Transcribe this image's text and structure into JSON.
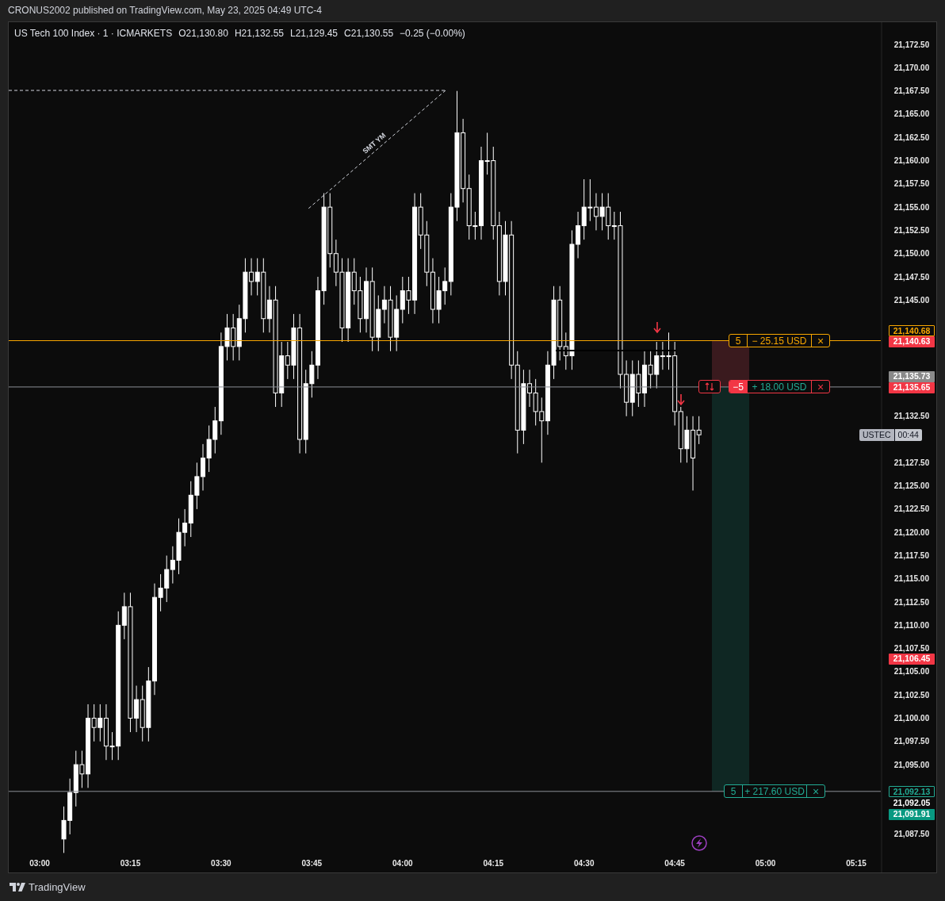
{
  "attribution": "CRONUS2002 published on TradingView.com, May 23, 2025 04:49 UTC-4",
  "legend": {
    "title": "US Tech 100 Index · 1 · ICMARKETS",
    "values": [
      "O21,130.80",
      "H21,132.55",
      "L21,129.45",
      "C21,130.55"
    ],
    "change": "−0.25 (−0.00%)"
  },
  "chart": {
    "chart_data": {
      "type": "candlestick",
      "categories": [
        "03:00",
        null,
        null,
        null,
        null,
        null,
        null,
        null,
        null,
        null,
        null,
        null,
        null,
        null,
        null,
        "03:15",
        null,
        null,
        null,
        null,
        null,
        null,
        null,
        null,
        null,
        null,
        null,
        null,
        null,
        null,
        "03:30",
        null,
        null,
        null,
        null,
        null,
        null,
        null,
        null,
        null,
        null,
        null,
        null,
        null,
        null,
        "03:45",
        null,
        null,
        null,
        null,
        null,
        null,
        null,
        null,
        null,
        null,
        null,
        null,
        null,
        null,
        "04:00",
        null,
        null,
        null,
        null,
        null,
        null,
        null,
        null,
        null,
        null,
        null,
        null,
        null,
        null,
        "04:15",
        null,
        null,
        null,
        null,
        null,
        null,
        null,
        null,
        null,
        null,
        null,
        null,
        null,
        null,
        "04:30",
        null,
        null,
        null,
        null,
        null,
        null,
        null,
        null,
        null,
        null,
        null,
        null,
        null,
        null,
        "04:45",
        null,
        null,
        null,
        null,
        null,
        null,
        null,
        null,
        null,
        null,
        null,
        null,
        null,
        null,
        "05:00",
        null,
        null,
        null,
        null,
        null,
        null,
        null,
        null,
        null,
        null,
        null,
        null,
        null,
        null,
        "05:15"
      ],
      "ohlc": [
        null,
        null,
        null,
        null,
        [
          21087,
          21090.5,
          21085.5,
          21089
        ],
        [
          21089,
          21093.5,
          21087.5,
          21092
        ],
        [
          21092,
          21096.5,
          21090.5,
          21095
        ],
        [
          21095,
          21096.5,
          21092.5,
          21094
        ],
        [
          21094,
          21101.5,
          21092.5,
          21100
        ],
        [
          21100,
          21101.5,
          21097.5,
          21099
        ],
        [
          21099,
          21101.5,
          21097.5,
          21100
        ],
        [
          21100,
          21101.5,
          21095.5,
          21097
        ],
        [
          21097,
          21098.5,
          21095.5,
          21097
        ],
        [
          21097,
          21111.5,
          21095.5,
          21110
        ],
        [
          21110,
          21113.5,
          21108.5,
          21112
        ],
        [
          21112,
          21113.5,
          21098.5,
          21100
        ],
        [
          21100,
          21103.5,
          21098.5,
          21102
        ],
        [
          21102,
          21103.5,
          21097.5,
          21099
        ],
        [
          21099,
          21105.5,
          21097.5,
          21104
        ],
        [
          21104,
          21114.5,
          21102.5,
          21113
        ],
        [
          21113,
          21115.5,
          21111.5,
          21114
        ],
        [
          21114,
          21117.5,
          21112.5,
          21116
        ],
        [
          21116,
          21118.5,
          21114.5,
          21117
        ],
        [
          21117,
          21121.5,
          21115.5,
          21120
        ],
        [
          21120,
          21122.5,
          21118.5,
          21121
        ],
        [
          21121,
          21125.5,
          21119.5,
          21124
        ],
        [
          21124,
          21127.5,
          21122.5,
          21126
        ],
        [
          21126,
          21129.5,
          21124.5,
          21128
        ],
        [
          21128,
          21131.5,
          21126.5,
          21130
        ],
        [
          21130,
          21133.5,
          21128.5,
          21132
        ],
        [
          21132,
          21141.5,
          21130.5,
          21140
        ],
        [
          21140,
          21143.5,
          21138.5,
          21142
        ],
        [
          21142,
          21143.5,
          21138.5,
          21140
        ],
        [
          21140,
          21144.5,
          21138.5,
          21143
        ],
        [
          21143,
          21149.5,
          21141.5,
          21148
        ],
        [
          21148,
          21149.5,
          21145.5,
          21147
        ],
        [
          21147,
          21149.5,
          21145.5,
          21148
        ],
        [
          21148,
          21149.5,
          21141.5,
          21143
        ],
        [
          21143,
          21146.5,
          21141.5,
          21145
        ],
        [
          21145,
          21146.5,
          21133.5,
          21135
        ],
        [
          21135,
          21140.5,
          21133.5,
          21139
        ],
        [
          21139,
          21140.5,
          21136.5,
          21138
        ],
        [
          21138,
          21143.5,
          21136.5,
          21142
        ],
        [
          21142,
          21143.5,
          21128.5,
          21130
        ],
        [
          21130,
          21137.5,
          21128.5,
          21136
        ],
        [
          21136,
          21139.5,
          21134.5,
          21138
        ],
        [
          21138,
          21147.5,
          21136.5,
          21146
        ],
        [
          21146,
          21156.5,
          21144.5,
          21155
        ],
        [
          21155,
          21156.5,
          21148.5,
          21150
        ],
        [
          21150,
          21151.5,
          21146.5,
          21148
        ],
        [
          21148,
          21149.5,
          21140.5,
          21142
        ],
        [
          21142,
          21149.5,
          21140.5,
          21148
        ],
        [
          21148,
          21149.5,
          21144.5,
          21146
        ],
        [
          21146,
          21147.5,
          21141.5,
          21143
        ],
        [
          21143,
          21148.5,
          21141.5,
          21147
        ],
        [
          21147,
          21148.5,
          21139.5,
          21141
        ],
        [
          21141,
          21145.5,
          21139.5,
          21144
        ],
        [
          21144,
          21146.5,
          21142.5,
          21145
        ],
        [
          21145,
          21146.5,
          21139.5,
          21141
        ],
        [
          21141,
          21145.5,
          21139.5,
          21144
        ],
        [
          21144,
          21147.5,
          21142.5,
          21146
        ],
        [
          21146,
          21147.5,
          21143.5,
          21145
        ],
        [
          21145,
          21156.5,
          21143.5,
          21155
        ],
        [
          21155,
          21156.5,
          21150.5,
          21152
        ],
        [
          21152,
          21153.5,
          21146.5,
          21148
        ],
        [
          21148,
          21149.5,
          21142.5,
          21144
        ],
        [
          21144,
          21147.5,
          21142.5,
          21146
        ],
        [
          21146,
          21148.5,
          21144.5,
          21147
        ],
        [
          21147,
          21156.5,
          21145.5,
          21155
        ],
        [
          21155,
          21167.5,
          21153.5,
          21163
        ],
        [
          21163,
          21164.5,
          21155.5,
          21157
        ],
        [
          21157,
          21158.5,
          21151.5,
          21153
        ],
        [
          21153,
          21154.5,
          21151.5,
          21153
        ],
        [
          21153,
          21161.5,
          21151.5,
          21160
        ],
        [
          21160,
          21163,
          21158.5,
          21160
        ],
        [
          21160,
          21161.5,
          21151.5,
          21153
        ],
        [
          21153,
          21154.5,
          21145.5,
          21147
        ],
        [
          21147,
          21153.5,
          21145.5,
          21152
        ],
        [
          21152,
          21153.5,
          21136.5,
          21138
        ],
        [
          21138,
          21139.5,
          21128.5,
          21131
        ],
        [
          21131,
          21137.5,
          21129.5,
          21136
        ],
        [
          21136,
          21137.5,
          21133.5,
          21135
        ],
        [
          21135,
          21136.5,
          21131.5,
          21133
        ],
        [
          21133,
          21134.5,
          21127.5,
          21132
        ],
        [
          21132,
          21139.5,
          21130.5,
          21138
        ],
        [
          21138,
          21146.5,
          21136.5,
          21145
        ],
        [
          21145,
          21146.5,
          21138.5,
          21140
        ],
        [
          21140,
          21141.5,
          21137.5,
          21139
        ],
        [
          21139,
          21152.5,
          21137.5,
          21151
        ],
        [
          21151,
          21154.5,
          21149.5,
          21153
        ],
        [
          21153,
          21158,
          21151.5,
          21155
        ],
        [
          21155,
          21158,
          21153.5,
          21155
        ],
        [
          21155,
          21156.5,
          21152.5,
          21154
        ],
        [
          21154,
          21156.5,
          21152.5,
          21155
        ],
        [
          21155,
          21156.5,
          21151.5,
          21153
        ],
        [
          21153,
          21154.5,
          21151.5,
          21153
        ],
        [
          21153,
          21154.5,
          21135.5,
          21137
        ],
        [
          21137,
          21138.5,
          21132.5,
          21134
        ],
        [
          21134,
          21138.5,
          21132.5,
          21137
        ],
        [
          21137,
          21138.5,
          21133.5,
          21135
        ],
        [
          21135,
          21139.5,
          21133.5,
          21138
        ],
        [
          21138,
          21139.5,
          21135.5,
          21137
        ],
        [
          21137,
          21140.5,
          21135.5,
          21139
        ],
        [
          21139,
          21140.5,
          21137.5,
          21139
        ],
        [
          21139,
          21141.5,
          21137.5,
          21139
        ],
        [
          21139,
          21140.5,
          21131.5,
          21133
        ],
        [
          21133,
          21133.5,
          21127.5,
          21129
        ],
        [
          21129,
          21132.5,
          21127.5,
          21131
        ],
        [
          21131,
          21132.5,
          21124.5,
          21128
        ],
        [
          21131,
          21132.5,
          21129.5,
          21130.5
        ],
        null,
        null,
        null,
        null,
        null,
        null,
        null,
        null,
        null,
        null,
        null,
        null,
        null,
        null,
        null,
        null,
        null,
        null,
        null,
        null,
        null,
        null,
        null,
        null,
        null,
        null
      ],
      "ylim": [
        21083.4,
        21174.9
      ],
      "yticks": [
        {
          "value": 21172.5,
          "label": "21,172.50"
        },
        {
          "value": 21170,
          "label": "21,170.00"
        },
        {
          "value": 21167.5,
          "label": "21,167.50"
        },
        {
          "value": 21165,
          "label": "21,165.00"
        },
        {
          "value": 21162.5,
          "label": "21,162.50"
        },
        {
          "value": 21160,
          "label": "21,160.00"
        },
        {
          "value": 21157.5,
          "label": "21,157.50"
        },
        {
          "value": 21155,
          "label": "21,155.00"
        },
        {
          "value": 21152.5,
          "label": "21,152.50"
        },
        {
          "value": 21150,
          "label": "21,150.00"
        },
        {
          "value": 21147.5,
          "label": "21,147.50"
        },
        {
          "value": 21145,
          "label": "21,145.00"
        },
        {
          "value": 21132.5,
          "label": "21,132.50"
        },
        {
          "value": 21127.5,
          "label": "21,127.50"
        },
        {
          "value": 21125,
          "label": "21,125.00"
        },
        {
          "value": 21122.5,
          "label": "21,122.50"
        },
        {
          "value": 21120,
          "label": "21,120.00"
        },
        {
          "value": 21117.5,
          "label": "21,117.50"
        },
        {
          "value": 21115,
          "label": "21,115.00"
        },
        {
          "value": 21112.5,
          "label": "21,112.50"
        },
        {
          "value": 21110,
          "label": "21,110.00"
        },
        {
          "value": 21107.5,
          "label": "21,107.50"
        },
        {
          "value": 21105,
          "label": "21,105.00"
        },
        {
          "value": 21102.5,
          "label": "21,102.50"
        },
        {
          "value": 21100,
          "label": "21,100.00"
        },
        {
          "value": 21097.5,
          "label": "21,097.50"
        },
        {
          "value": 21095,
          "label": "21,095.00"
        },
        {
          "value": 21087.5,
          "label": "21,087.50"
        }
      ]
    },
    "drawing_label": "SMT YM",
    "orders": [
      {
        "kind": "stop",
        "quantity": "5",
        "quantity_filled": false,
        "pnl": "− 25.15 USD",
        "close": "×",
        "reverse_button": false
      },
      {
        "kind": "entry",
        "quantity": "−5",
        "quantity_filled": true,
        "pnl": "+ 18.00 USD",
        "close": "×",
        "reverse_button": true
      },
      {
        "kind": "target",
        "quantity": "5",
        "quantity_filled": false,
        "pnl": "+ 217.60 USD",
        "close": "×",
        "reverse_button": false
      }
    ],
    "price_labels": [
      {
        "kind": "order",
        "text": "21,140.68",
        "color": "#f7a600"
      },
      {
        "kind": "marker",
        "text": "21,140.63",
        "color": "#f23645"
      },
      {
        "kind": "marker",
        "text": "21,135.73",
        "color": "#8a8a8a"
      },
      {
        "kind": "marker",
        "text": "21,135.65",
        "color": "#f23645"
      },
      {
        "kind": "marker",
        "text": "21,106.45",
        "color": "#f23645"
      },
      {
        "kind": "order",
        "text": "21,092.13",
        "color": "#22ab94"
      },
      {
        "kind": "level",
        "text": "21,092.05"
      },
      {
        "kind": "marker",
        "text": "21,091.91",
        "color": "#089981"
      }
    ],
    "symbol_badge": {
      "symbol": "USTEC",
      "countdown": "00:44"
    }
  },
  "footer": {
    "brand": "TradingView"
  }
}
